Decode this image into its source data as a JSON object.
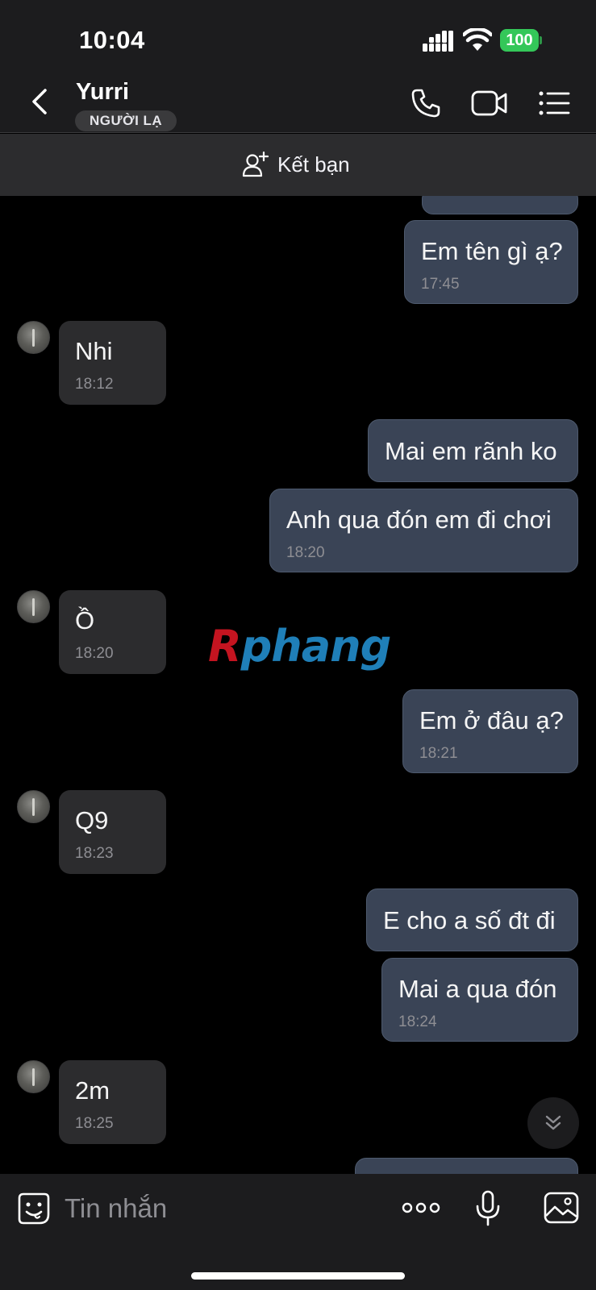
{
  "status_bar": {
    "time": "10:04",
    "battery": "100"
  },
  "header": {
    "name": "Yurri",
    "badge": "NGƯỜI LẠ"
  },
  "friend_bar": {
    "label": "Kết bạn"
  },
  "messages": [
    {
      "direction": "out",
      "text": "",
      "time": ""
    },
    {
      "direction": "out",
      "text": "Em tên gì ạ?",
      "time": "17:45"
    },
    {
      "direction": "in",
      "text": "Nhi",
      "time": "18:12"
    },
    {
      "direction": "out",
      "text": "Mai em rãnh ko",
      "time": ""
    },
    {
      "direction": "out",
      "text": "Anh qua đón em đi chơi",
      "time": "18:20"
    },
    {
      "direction": "in",
      "text": "Ồ",
      "time": "18:20"
    },
    {
      "direction": "out",
      "text": "Em ở đâu ạ?",
      "time": "18:21"
    },
    {
      "direction": "in",
      "text": "Q9",
      "time": "18:23"
    },
    {
      "direction": "out",
      "text": "E cho a số đt đi",
      "time": ""
    },
    {
      "direction": "out",
      "text": "Mai a qua đón",
      "time": "18:24"
    },
    {
      "direction": "in",
      "text": "2m",
      "time": "18:25"
    }
  ],
  "watermark": {
    "part1": "R",
    "part2": "phang"
  },
  "input": {
    "placeholder": "Tin nhắn"
  }
}
